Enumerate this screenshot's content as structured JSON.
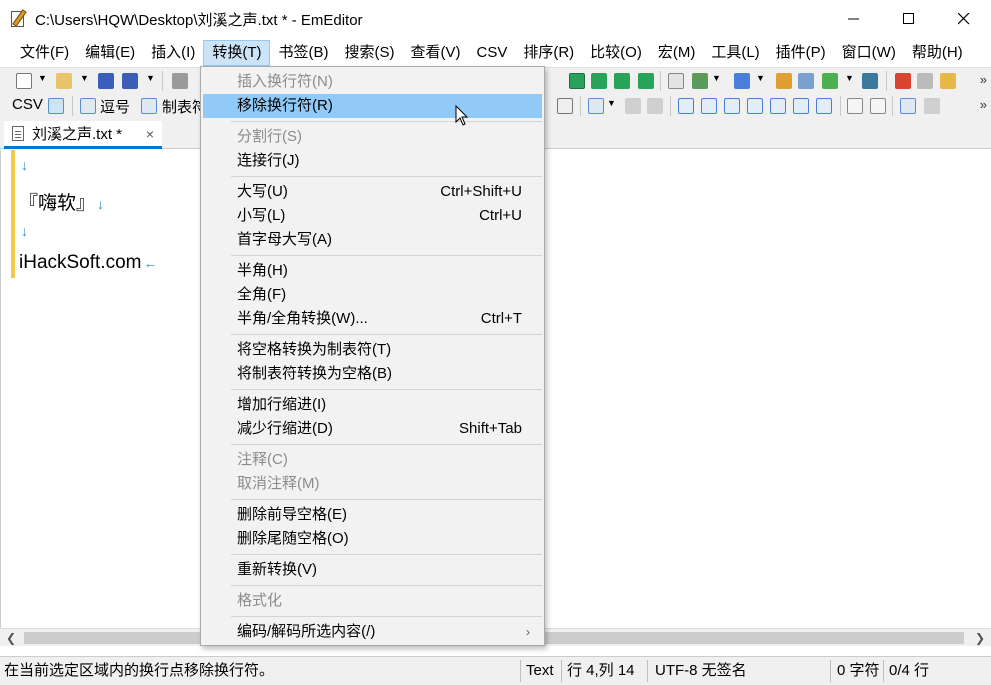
{
  "window": {
    "title": "C:\\Users\\HQW\\Desktop\\刘溪之声.txt * - EmEditor",
    "min_icon": "minimize-icon",
    "max_icon": "maximize-icon",
    "close_icon": "close-icon"
  },
  "menubar": {
    "items": [
      "文件(F)",
      "编辑(E)",
      "插入(I)",
      "转换(T)",
      "书签(B)",
      "搜索(S)",
      "查看(V)",
      "CSV",
      "排序(R)",
      "比较(O)",
      "宏(M)",
      "工具(L)",
      "插件(P)",
      "窗口(W)",
      "帮助(H)"
    ],
    "active_index": 3
  },
  "toolbar2": {
    "csv_label": "CSV",
    "comma_label": "逗号",
    "tab_label": "制表符"
  },
  "tab": {
    "label": "刘溪之声.txt *",
    "close": "×"
  },
  "editor": {
    "lines": [
      "",
      "『嗨软』",
      "",
      "iHackSoft.com"
    ],
    "newline_mark": "↓",
    "eof_mark": "←"
  },
  "dropdown": {
    "items": [
      {
        "label": "插入换行符(N)",
        "shortcut": "",
        "disabled": true
      },
      {
        "label": "移除换行符(R)",
        "shortcut": "",
        "disabled": false,
        "hover": true
      },
      {
        "label": "分割行(S)",
        "shortcut": "",
        "disabled": true
      },
      {
        "label": "连接行(J)",
        "shortcut": "",
        "disabled": false
      },
      {
        "label": "大写(U)",
        "shortcut": "Ctrl+Shift+U",
        "disabled": false
      },
      {
        "label": "小写(L)",
        "shortcut": "Ctrl+U",
        "disabled": false
      },
      {
        "label": "首字母大写(A)",
        "shortcut": "",
        "disabled": false
      },
      {
        "label": "半角(H)",
        "shortcut": "",
        "disabled": false
      },
      {
        "label": "全角(F)",
        "shortcut": "",
        "disabled": false
      },
      {
        "label": "半角/全角转换(W)...",
        "shortcut": "Ctrl+T",
        "disabled": false
      },
      {
        "label": "将空格转换为制表符(T)",
        "shortcut": "",
        "disabled": false
      },
      {
        "label": "将制表符转换为空格(B)",
        "shortcut": "",
        "disabled": false
      },
      {
        "label": "增加行缩进(I)",
        "shortcut": "",
        "disabled": false
      },
      {
        "label": "减少行缩进(D)",
        "shortcut": "Shift+Tab",
        "disabled": false
      },
      {
        "label": "注释(C)",
        "shortcut": "",
        "disabled": true
      },
      {
        "label": "取消注释(M)",
        "shortcut": "",
        "disabled": true
      },
      {
        "label": "删除前导空格(E)",
        "shortcut": "",
        "disabled": false
      },
      {
        "label": "删除尾随空格(O)",
        "shortcut": "",
        "disabled": false
      },
      {
        "label": "重新转换(V)",
        "shortcut": "",
        "disabled": false
      },
      {
        "label": "格式化",
        "shortcut": "",
        "disabled": true
      },
      {
        "label": "编码/解码所选内容(/)",
        "shortcut": "",
        "disabled": false,
        "submenu": true
      }
    ],
    "submenu_arrow": "›"
  },
  "statusbar": {
    "message": "在当前选定区域内的换行点移除换行符。",
    "mode": "Text",
    "position": "行 4,列 14",
    "encoding": "UTF-8 无签名",
    "chars": "0 字符",
    "lines": "0/4 行"
  },
  "colors": {
    "menu_active_bg": "#cce4f7",
    "dropdown_hover_bg": "#91c9f7",
    "tab_underline": "#0078d7",
    "margin_marker": "#f2c94c",
    "newline_mark": "#2e8bd8"
  }
}
